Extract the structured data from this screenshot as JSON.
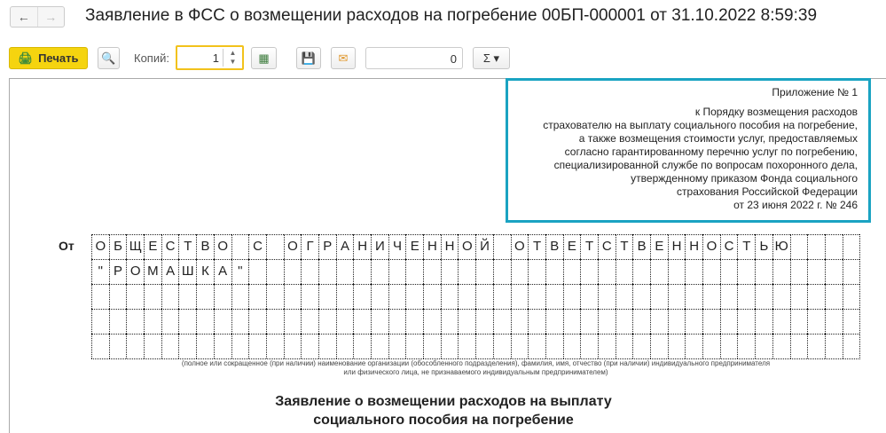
{
  "window": {
    "title": "Заявление в ФСС о возмещении расходов на погребение 00БП-000001 от 31.10.2022 8:59:39"
  },
  "toolbar": {
    "print_label": "Печать",
    "copies_label": "Копий:",
    "copies_value": "1",
    "number_value": "0",
    "sum_label": "Σ ▾"
  },
  "appendix": {
    "heading": "Приложение № 1",
    "lines": [
      "к Порядку возмещения расходов",
      "страхователю на выплату социального пособия на погребение,",
      "а также возмещения стоимости услуг, предоставляемых",
      "согласно гарантированному перечню услуг по погребению,",
      "специализированной службе по вопросам похоронного дела,",
      "утвержденному приказом Фонда социального",
      "страхования Российской Федерации",
      "от 23 июня 2022 г. № 246"
    ]
  },
  "form": {
    "from_label": "От",
    "rows": [
      "ОБЩЕСТВО С ОГРАНИЧЕННОЙ ОТВЕТСТВЕННОСТЬЮ",
      "\"РОМАШКА\"",
      "",
      "",
      ""
    ],
    "note_line1": "(полное или сокращенное (при наличии) наименование организации (обособленного подразделения), фамилия, имя, отчество (при наличии) индивидуального предпринимателя",
    "note_line2": "или физического лица, не признаваемого индивидуальным предпринимателем)",
    "heading_line1": "Заявление о возмещении расходов на выплату",
    "heading_line2": "социального пособия на погребение"
  }
}
